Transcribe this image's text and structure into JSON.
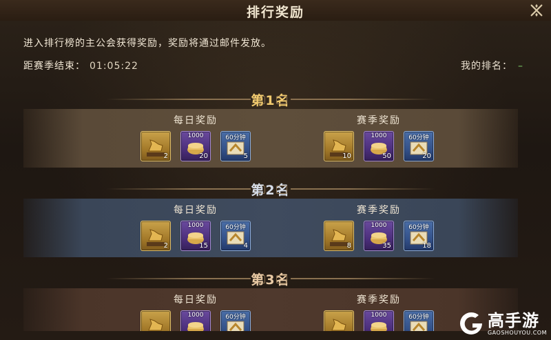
{
  "header": {
    "title": "排行奖励",
    "close_icon": "close-x-icon"
  },
  "intro_text": "进入排行榜的主公会获得奖励，奖励将通过邮件发放。",
  "season_end": {
    "label": "距赛季结束：",
    "value": "01:05:22"
  },
  "my_rank": {
    "label": "我的排名：",
    "value": "–"
  },
  "ranks": [
    {
      "title": "第1名",
      "daily": {
        "title": "每日奖励",
        "items": [
          {
            "icon": "bronze-horse-icon",
            "top": "",
            "count": "2"
          },
          {
            "icon": "gold-scroll-icon",
            "top": "1000",
            "count": "20"
          },
          {
            "icon": "speedup-scroll-icon",
            "top": "60分钟",
            "count": "5"
          }
        ]
      },
      "season": {
        "title": "赛季奖励",
        "items": [
          {
            "icon": "bronze-horse-icon",
            "top": "",
            "count": "10"
          },
          {
            "icon": "gold-scroll-icon",
            "top": "1000",
            "count": "50"
          },
          {
            "icon": "speedup-scroll-icon",
            "top": "60分钟",
            "count": "20"
          }
        ]
      }
    },
    {
      "title": "第2名",
      "daily": {
        "title": "每日奖励",
        "items": [
          {
            "icon": "bronze-horse-icon",
            "top": "",
            "count": "2"
          },
          {
            "icon": "gold-scroll-icon",
            "top": "1000",
            "count": "15"
          },
          {
            "icon": "speedup-scroll-icon",
            "top": "60分钟",
            "count": "4"
          }
        ]
      },
      "season": {
        "title": "赛季奖励",
        "items": [
          {
            "icon": "bronze-horse-icon",
            "top": "",
            "count": "8"
          },
          {
            "icon": "gold-scroll-icon",
            "top": "1000",
            "count": "35"
          },
          {
            "icon": "speedup-scroll-icon",
            "top": "60分钟",
            "count": "18"
          }
        ]
      }
    },
    {
      "title": "第3名",
      "daily": {
        "title": "每日奖励",
        "items": [
          {
            "icon": "bronze-horse-icon",
            "top": "",
            "count": ""
          },
          {
            "icon": "gold-scroll-icon",
            "top": "1000",
            "count": ""
          },
          {
            "icon": "speedup-scroll-icon",
            "top": "60分钟",
            "count": ""
          }
        ]
      },
      "season": {
        "title": "赛季奖励",
        "items": [
          {
            "icon": "bronze-horse-icon",
            "top": "",
            "count": ""
          },
          {
            "icon": "gold-scroll-icon",
            "top": "1000",
            "count": ""
          },
          {
            "icon": "speedup-scroll-icon",
            "top": "60分钟",
            "count": ""
          }
        ]
      }
    }
  ],
  "watermark": {
    "name": "高手游",
    "url": "GAOSHOUYOU.COM"
  }
}
